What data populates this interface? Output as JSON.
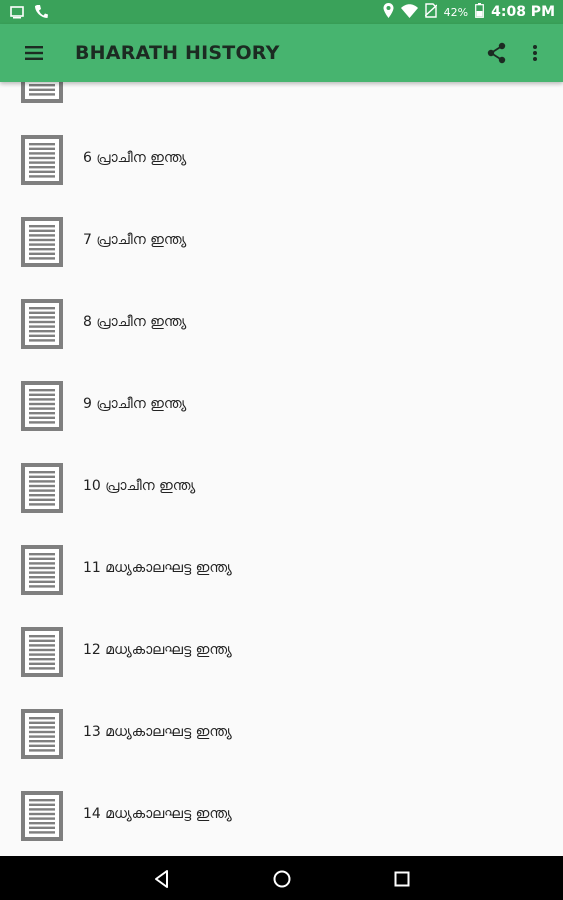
{
  "status_bar": {
    "battery_percent": "42%",
    "time": "4:08 PM",
    "icons": [
      "screen-icon",
      "phone-icon",
      "location-icon",
      "wifi-icon",
      "no-sim-icon",
      "battery-icon"
    ]
  },
  "app_bar": {
    "title": "BHARATH HISTORY",
    "icons": [
      "menu-icon",
      "share-icon",
      "more-vert-icon"
    ]
  },
  "list": {
    "items": [
      {
        "label": "",
        "icon": "document-icon"
      },
      {
        "label": "6 പ്രാചീന ഇന്ത്യ",
        "icon": "document-icon"
      },
      {
        "label": "7 പ്രാചീന ഇന്ത്യ",
        "icon": "document-icon"
      },
      {
        "label": "8 പ്രാചീന ഇന്ത്യ",
        "icon": "document-icon"
      },
      {
        "label": "9 പ്രാചീന ഇന്ത്യ",
        "icon": "document-icon"
      },
      {
        "label": "10 പ്രാചീന ഇന്ത്യ",
        "icon": "document-icon"
      },
      {
        "label": "11 മധ്യകാലഘട്ട ഇന്ത്യ",
        "icon": "document-icon"
      },
      {
        "label": "12 മധ്യകാലഘട്ട ഇന്ത്യ",
        "icon": "document-icon"
      },
      {
        "label": "13 മധ്യകാലഘട്ട ഇന്ത്യ",
        "icon": "document-icon"
      },
      {
        "label": "14 മധ്യകാലഘട്ട ഇന്ത്യ",
        "icon": "document-icon"
      }
    ]
  },
  "nav_bar": {
    "icons": [
      "back-icon",
      "home-icon",
      "recents-icon"
    ]
  },
  "colors": {
    "status_bar": "#3aa25a",
    "app_bar": "#47b46f",
    "list_background": "#fafafa",
    "icon_gray": "#7f7f7f"
  }
}
